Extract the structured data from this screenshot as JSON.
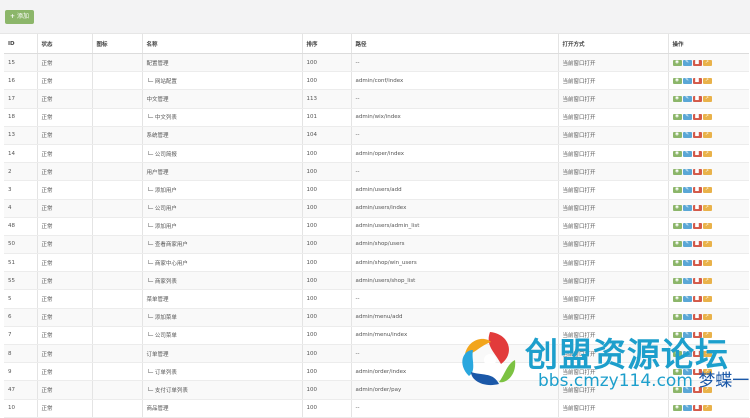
{
  "toolbar": {
    "add_label": "添加"
  },
  "table": {
    "headers": [
      "ID",
      "状态",
      "图标",
      "名称",
      "排序",
      "路径",
      "打开方式",
      "操作"
    ],
    "rows": [
      [
        "15",
        "正常",
        "",
        "配置管理",
        "100",
        "--",
        "当前窗口打开"
      ],
      [
        "16",
        "正常",
        "",
        "└─ 网站配置",
        "100",
        "admin/conf/index",
        "当前窗口打开"
      ],
      [
        "17",
        "正常",
        "",
        "中文管理",
        "113",
        "--",
        "当前窗口打开"
      ],
      [
        "18",
        "正常",
        "",
        "└─ 中文列表",
        "101",
        "admin/wix/index",
        "当前窗口打开"
      ],
      [
        "13",
        "正常",
        "",
        "系统管理",
        "104",
        "--",
        "当前窗口打开"
      ],
      [
        "14",
        "正常",
        "",
        "└─ 公司简报",
        "100",
        "admin/oper/index",
        "当前窗口打开"
      ],
      [
        "2",
        "正常",
        "",
        "用户管理",
        "100",
        "--",
        "当前窗口打开"
      ],
      [
        "3",
        "正常",
        "",
        "└─ 添加用户",
        "100",
        "admin/users/add",
        "当前窗口打开"
      ],
      [
        "4",
        "正常",
        "",
        "└─ 公司用户",
        "100",
        "admin/users/index",
        "当前窗口打开"
      ],
      [
        "48",
        "正常",
        "",
        "└─ 添加用户",
        "100",
        "admin/users/admin_list",
        "当前窗口打开"
      ],
      [
        "50",
        "正常",
        "",
        "└─ 查看商家用户",
        "100",
        "admin/shop/users",
        "当前窗口打开"
      ],
      [
        "51",
        "正常",
        "",
        "└─ 商家中心用户",
        "100",
        "admin/shop/win_users",
        "当前窗口打开"
      ],
      [
        "55",
        "正常",
        "",
        "└─ 商家列表",
        "100",
        "admin/users/shop_list",
        "当前窗口打开"
      ],
      [
        "5",
        "正常",
        "",
        "菜单管理",
        "100",
        "--",
        "当前窗口打开"
      ],
      [
        "6",
        "正常",
        "",
        "└─ 添加菜单",
        "100",
        "admin/menu/add",
        "当前窗口打开"
      ],
      [
        "7",
        "正常",
        "",
        "└─ 公司菜单",
        "100",
        "admin/menu/index",
        "当前窗口打开"
      ],
      [
        "8",
        "正常",
        "",
        "订单管理",
        "100",
        "--",
        "当前窗口打开"
      ],
      [
        "9",
        "正常",
        "",
        "└─ 订单列表",
        "100",
        "admin/order/index",
        "当前窗口打开"
      ],
      [
        "47",
        "正常",
        "",
        "└─ 支付订单列表",
        "100",
        "admin/order/pay",
        "当前窗口打开"
      ],
      [
        "10",
        "正常",
        "",
        "商品管理",
        "100",
        "--",
        "当前窗口打开"
      ]
    ],
    "op_icons": [
      "eye-icon",
      "edit-icon",
      "trash-icon",
      "share-icon"
    ]
  },
  "watermark": {
    "title": "创盟资源论坛",
    "url": "bbs.cmzy114.com",
    "tagline": "梦蝶一元购"
  },
  "colors": {
    "add": "#8cb66a",
    "view": "#8cb66a",
    "edit": "#5aa7d6",
    "del": "#d35a4a",
    "more": "#e9b24a",
    "brand": "#1d9fcc"
  }
}
